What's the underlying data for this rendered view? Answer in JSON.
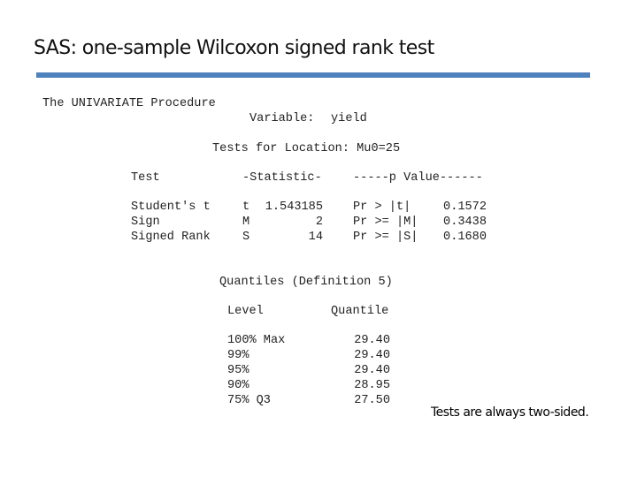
{
  "slide": {
    "title": "SAS: one-sample Wilcoxon signed rank test",
    "accent_color": "#4f81bd",
    "note": "Tests are always two-sided."
  },
  "output": {
    "procedure": "The UNIVARIATE Procedure",
    "variable_label": "Variable:",
    "variable_name": "yield",
    "location_title": "Tests for Location: Mu0=25",
    "location_table": {
      "headers": {
        "test": "Test",
        "statistic": "-Statistic-",
        "pvalue": "-----p Value------"
      },
      "rows": [
        {
          "test": "Student's t",
          "stat_symbol": "t",
          "stat_value": "1.543185",
          "p_label": "Pr > |t|",
          "p_value": "0.1572"
        },
        {
          "test": "Sign",
          "stat_symbol": "M",
          "stat_value": "2",
          "p_label": "Pr >= |M|",
          "p_value": "0.3438"
        },
        {
          "test": "Signed Rank",
          "stat_symbol": "S",
          "stat_value": "14",
          "p_label": "Pr >= |S|",
          "p_value": "0.1680"
        }
      ]
    },
    "quantiles_title": "Quantiles (Definition 5)",
    "quantiles_table": {
      "headers": {
        "level": "Level",
        "quantile": "Quantile"
      },
      "rows": [
        {
          "level": "100% Max",
          "quantile": "29.40"
        },
        {
          "level": "99%",
          "quantile": "29.40"
        },
        {
          "level": "95%",
          "quantile": "29.40"
        },
        {
          "level": "90%",
          "quantile": "28.95"
        },
        {
          "level": "75% Q3",
          "quantile": "27.50"
        }
      ]
    }
  }
}
